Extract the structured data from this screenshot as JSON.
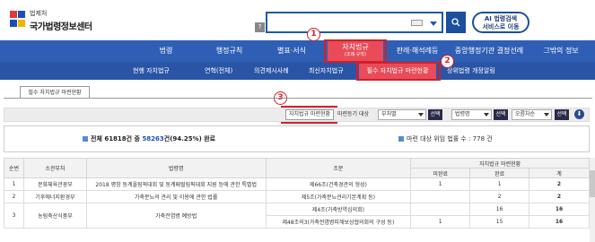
{
  "header": {
    "logo_sub": "법제처",
    "logo_main": "국가법령정보센터",
    "help": "?",
    "search_placeholder": "",
    "search_icon": "magnifier-icon",
    "ai_line1": "AI 법령검색",
    "ai_line2": "서비스로 이동"
  },
  "gnb": {
    "items": [
      "법령",
      "행정규칙",
      "별표·서식",
      "자치법규",
      "판례·해석례등",
      "중앙행정기관 결정선례",
      "그밖의 정보"
    ],
    "active_sub": "(조례·규칙)"
  },
  "lnb": {
    "items": [
      "현행 자치법규",
      "연혁(전체)",
      "의견제시사례",
      "최신자치법규",
      "필수 자치법규 마련현황",
      "상위법령 개정알림"
    ]
  },
  "badges": [
    "1",
    "2",
    "3"
  ],
  "tab": "필수 자치법규 마련현황",
  "toolbar": {
    "map_btn": "자치법규 마련현황",
    "target_label": "마련등기 대상",
    "select1": "부처별",
    "select2": "법령명",
    "select3": "오름차순",
    "choose": "선택",
    "download": "⬇"
  },
  "summary": {
    "left_prefix": "전체 61818건 중 ",
    "left_count": "58263",
    "left_suffix": "건(94.25%) 완료",
    "right": "마련 대상 위임 법률 수 : 778 건"
  },
  "table": {
    "headers": {
      "no": "순번",
      "ministry": "소관부처",
      "law": "법령명",
      "article": "조문",
      "status": "자치법규 마련현황",
      "unmade": "미완료",
      "done": "완료",
      "total": "계"
    },
    "rows": [
      {
        "no": "1",
        "ministry": "문화체육관광부",
        "law": "2018 평창 동계올림픽대회 및 동계패럴림픽대회 지원 등에 관한 특별법",
        "article": "제66조(건축경관의 형성)",
        "unmade": "1",
        "done": "1",
        "total": "2"
      },
      {
        "no": "2",
        "ministry": "기후에너지환경부",
        "law": "가축분뇨의 관리 및 이용에 관한 법률",
        "article": "제5조(가축분뇨관리기본계획 등)",
        "unmade": "",
        "done": "2",
        "total": "2"
      },
      {
        "no": "3",
        "ministry": "농림축산식품부",
        "law": "가축전염병 예방법",
        "article": "제4조(가축방역심의회)",
        "unmade": "",
        "done": "16",
        "total": "16"
      },
      {
        "no": "",
        "ministry": "",
        "law": "",
        "article": "제48조의3(가축전염병피해보상협의회의 구성 등)",
        "unmade": "1",
        "done": "15",
        "total": "16"
      }
    ]
  }
}
